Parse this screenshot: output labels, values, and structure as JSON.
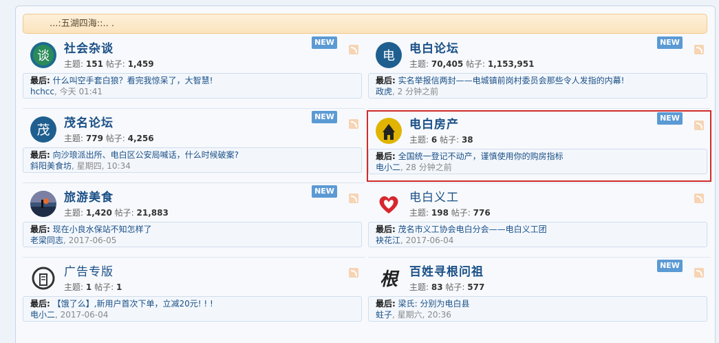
{
  "header": {
    "title": "...:五湖四海::.. ."
  },
  "new_label": "NEW",
  "stats_labels": {
    "topics": "主题:",
    "posts": "帖子:"
  },
  "last_label": "最后:",
  "forums": [
    {
      "title": "社会杂谈",
      "icon": "chat-bubble-icon",
      "topics": "151",
      "posts": "1,459",
      "has_new": true,
      "last_post": "什么叫空手套白狼？看完我惊呆了，大智慧!",
      "last_user": "hchcc",
      "last_time": "今天 01:41"
    },
    {
      "title": "电白论坛",
      "icon": "dianbai-logo-icon",
      "topics": "70,405",
      "posts": "1,153,951",
      "has_new": true,
      "last_post": "实名举报信两封——电城镇前岗村委员会那些令人发指的内幕!",
      "last_user": "政虎",
      "last_time": "2 分钟之前"
    },
    {
      "title": "茂名论坛",
      "icon": "mao-character-icon",
      "topics": "779",
      "posts": "4,256",
      "has_new": true,
      "last_post": "向沙琅派出所、电白区公安局喊话，什么时候破案?",
      "last_user": "斜阳美食坊",
      "last_time": "星期四, 10:34"
    },
    {
      "title": "电白房产",
      "icon": "house-icon",
      "topics": "6",
      "posts": "38",
      "has_new": true,
      "last_post": "全国统一登记不动产，谨慎使用你的购房指标",
      "last_user": "电小二",
      "last_time": "28 分钟之前"
    },
    {
      "title": "旅游美食",
      "icon": "sunset-landscape-icon",
      "topics": "1,420",
      "posts": "21,883",
      "has_new": true,
      "last_post": "现在小良水保站不知怎样了",
      "last_user": "老梁同志",
      "last_time": "2017-06-05"
    },
    {
      "title": "电白义工",
      "icon": "heart-icon",
      "topics": "198",
      "posts": "776",
      "has_new": false,
      "last_post": "茂名市义工协会电白分会——电白义工团",
      "last_user": "袂花江",
      "last_time": "2017-06-04"
    },
    {
      "title": "广告专版",
      "icon": "megaphone-icon",
      "topics": "1",
      "posts": "1",
      "has_new": false,
      "last_post": "【饿了么】,新用户首次下单，立减20元! ! !",
      "last_user": "电小二",
      "last_time": "2017-06-04"
    },
    {
      "title": "百姓寻根问祖",
      "icon": "gen-character-icon",
      "topics": "83",
      "posts": "577",
      "has_new": true,
      "last_post": "梁氏: 分别为电白县",
      "last_user": "蛀子",
      "last_time": "星期六, 20:36"
    }
  ]
}
